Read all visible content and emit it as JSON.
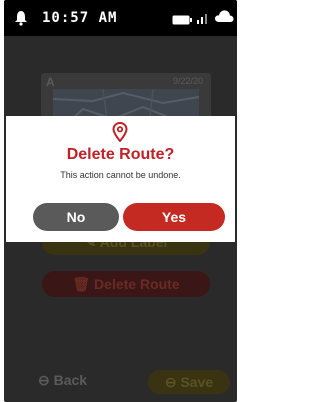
{
  "status_bar": {
    "time": "10:57 AM",
    "icons": [
      "bell-icon",
      "battery-icon",
      "signal-icon",
      "cloud-icon"
    ]
  },
  "background": {
    "route_card": {
      "letter": "A",
      "date": "9/22/20"
    },
    "add_label_button": "Add Label",
    "delete_route_button": "Delete Route",
    "back_button": "Back",
    "save_button": "Save"
  },
  "dialog": {
    "icon": "location-pin-icon",
    "title": "Delete Route?",
    "message": "This action cannot be undone.",
    "no_label": "No",
    "yes_label": "Yes"
  },
  "colors": {
    "accent_red": "#c42a22",
    "title_red": "#c02126",
    "neutral_button": "#5a5a5a",
    "overlay": "#2a2a2a"
  }
}
